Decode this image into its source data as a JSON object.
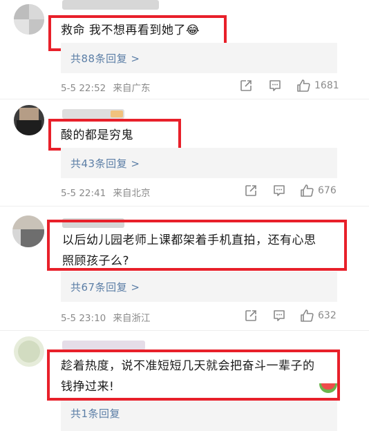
{
  "comments": [
    {
      "text_lines": [
        "救命 我不想再看到她了"
      ],
      "emoji": "😂",
      "replies_label": "共88条回复 >",
      "time": "5-5 22:52",
      "location": "来自广东",
      "likes": "1681"
    },
    {
      "text_lines": [
        "酸的都是穷鬼"
      ],
      "replies_label": "共43条回复 >",
      "time": "5-5 22:41",
      "location": "来自北京",
      "likes": "676"
    },
    {
      "text_lines": [
        "以后幼儿园老师上课都架着手机直拍，还有心思",
        "照顾孩子么?"
      ],
      "replies_label": "共67条回复 >",
      "time": "5-5 23:10",
      "location": "来自浙江",
      "likes": "632"
    },
    {
      "text_lines": [
        "趁着热度，说不准短短几天就会把奋斗一辈子的",
        "钱挣过来!"
      ],
      "replies_label": "共1条回复"
    }
  ],
  "colors": {
    "highlight": "#e8202a",
    "link": "#5b7ea6",
    "meta": "#8a8a8a",
    "reply_bg": "#f4f4f4"
  },
  "icons": [
    "share-icon",
    "comment-icon",
    "like-icon"
  ]
}
